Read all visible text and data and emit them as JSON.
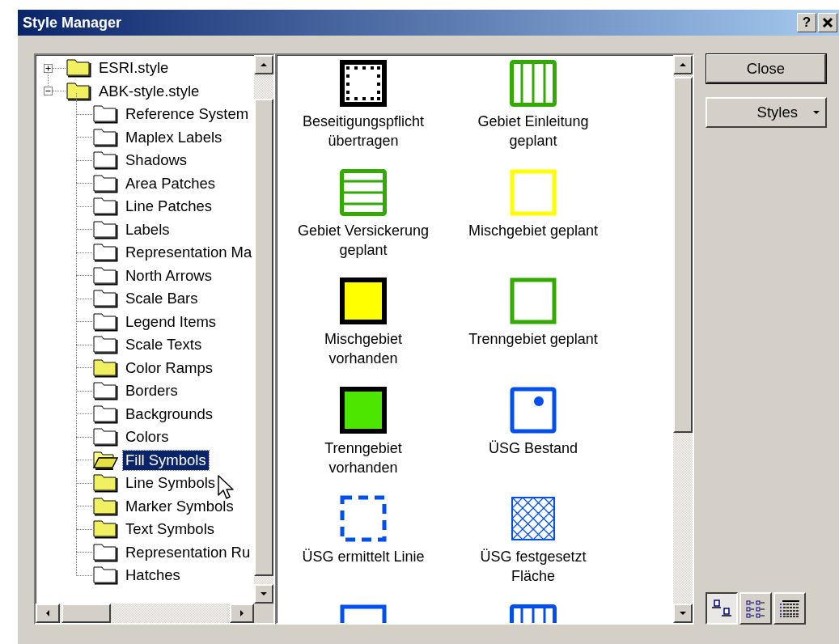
{
  "window": {
    "title": "Style Manager",
    "help_button": "?"
  },
  "tree": [
    {
      "label": "ESRI.style",
      "expanded": false,
      "has_items": true,
      "selected": false
    },
    {
      "label": "ABK-style.style",
      "expanded": true,
      "has_items": true,
      "selected": false,
      "children": [
        {
          "label": "Reference System",
          "has_items": false,
          "selected": false
        },
        {
          "label": "Maplex Labels",
          "has_items": false,
          "selected": false
        },
        {
          "label": "Shadows",
          "has_items": false,
          "selected": false
        },
        {
          "label": "Area Patches",
          "has_items": false,
          "selected": false
        },
        {
          "label": "Line Patches",
          "has_items": false,
          "selected": false
        },
        {
          "label": "Labels",
          "has_items": false,
          "selected": false
        },
        {
          "label": "Representation Ma",
          "has_items": false,
          "selected": false
        },
        {
          "label": "North Arrows",
          "has_items": false,
          "selected": false
        },
        {
          "label": "Scale Bars",
          "has_items": false,
          "selected": false
        },
        {
          "label": "Legend Items",
          "has_items": false,
          "selected": false
        },
        {
          "label": "Scale Texts",
          "has_items": false,
          "selected": false
        },
        {
          "label": "Color Ramps",
          "has_items": true,
          "selected": false
        },
        {
          "label": "Borders",
          "has_items": false,
          "selected": false
        },
        {
          "label": "Backgrounds",
          "has_items": false,
          "selected": false
        },
        {
          "label": "Colors",
          "has_items": false,
          "selected": false
        },
        {
          "label": "Fill Symbols",
          "has_items": true,
          "selected": true
        },
        {
          "label": "Line Symbols",
          "has_items": true,
          "selected": false
        },
        {
          "label": "Marker Symbols",
          "has_items": true,
          "selected": false
        },
        {
          "label": "Text Symbols",
          "has_items": true,
          "selected": false
        },
        {
          "label": "Representation Ru",
          "has_items": false,
          "selected": false
        },
        {
          "label": "Hatches",
          "has_items": false,
          "selected": false
        }
      ]
    }
  ],
  "symbols": [
    {
      "label": "Beseitigungspflicht übertragen",
      "kind": "dotted",
      "color": "#000000"
    },
    {
      "label": "Gebiet Einleitung geplant",
      "kind": "vertical-lines",
      "color": "#33aa00"
    },
    {
      "label": "Gebiet Versickerung geplant",
      "kind": "horizontal-lines",
      "color": "#33aa00"
    },
    {
      "label": "Mischgebiet geplant",
      "kind": "outline",
      "color": "#ffff00"
    },
    {
      "label": "Mischgebiet vorhanden",
      "kind": "filled",
      "color": "#ffff00"
    },
    {
      "label": "Trenngebiet geplant",
      "kind": "outline",
      "color": "#33aa00"
    },
    {
      "label": "Trenngebiet vorhanden",
      "kind": "filled",
      "color": "#4ce600"
    },
    {
      "label": "ÜSG Bestand",
      "kind": "dot",
      "color": "#0050f0"
    },
    {
      "label": "ÜSG ermittelt Linie",
      "kind": "dashed",
      "color": "#0050f0"
    },
    {
      "label": "ÜSG festgesetzt Fläche",
      "kind": "crosshatch",
      "color": "#0050f0"
    },
    {
      "kind": "outline",
      "color": "#0050f0"
    },
    {
      "kind": "vertical-lines",
      "color": "#0050f0"
    }
  ],
  "close_button": "Close",
  "styles_button": "Styles",
  "view_buttons": [
    {
      "kind": "large-icons",
      "selected": true
    },
    {
      "kind": "list",
      "selected": false
    },
    {
      "kind": "details",
      "selected": false
    }
  ]
}
